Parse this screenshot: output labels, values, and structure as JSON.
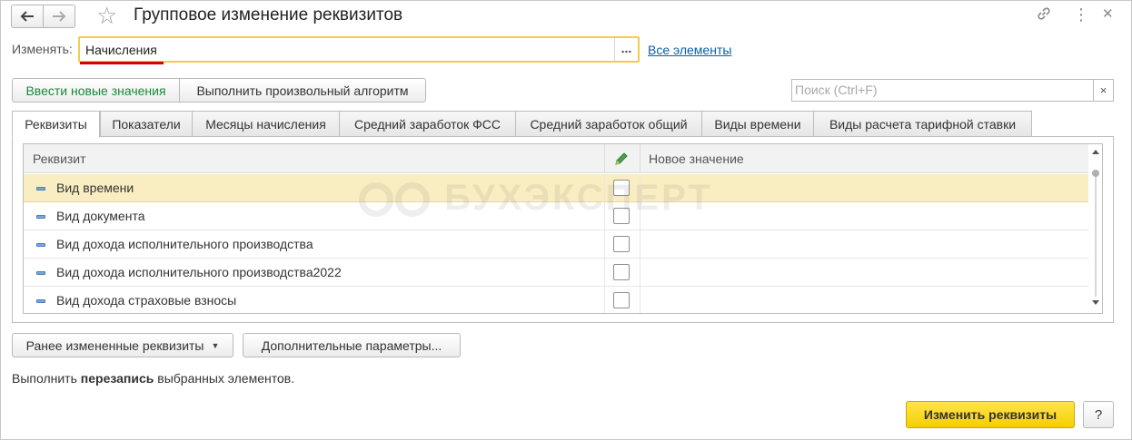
{
  "window": {
    "title": "Групповое изменение реквизитов",
    "back_icon": "arrow-left-icon",
    "forward_icon": "arrow-right-icon",
    "favorite_icon": "star-icon",
    "link_icon": "link-icon",
    "more_icon": "more-vertical-icon",
    "close_icon": "close-icon"
  },
  "change_row": {
    "label": "Изменять:",
    "value": "Начисления",
    "select_button": "...",
    "all_link": "Все элементы"
  },
  "toolbar": {
    "new_values": "Ввести новые значения",
    "custom_algorithm": "Выполнить произвольный алгоритм",
    "search_placeholder": "Поиск (Ctrl+F)",
    "search_clear": "×"
  },
  "tabs": [
    {
      "label": "Реквизиты",
      "active": true
    },
    {
      "label": "Показатели",
      "active": false
    },
    {
      "label": "Месяцы начисления",
      "active": false
    },
    {
      "label": "Средний заработок ФСС",
      "active": false
    },
    {
      "label": "Средний заработок общий",
      "active": false
    },
    {
      "label": "Виды времени",
      "active": false
    },
    {
      "label": "Виды расчета тарифной ставки",
      "active": false
    }
  ],
  "table": {
    "columns": {
      "attribute": "Реквизит",
      "new_value": "Новое значение"
    },
    "rows": [
      {
        "name": "Вид времени",
        "checked": false,
        "selected": true,
        "new_value": ""
      },
      {
        "name": "Вид документа",
        "checked": false,
        "selected": false,
        "new_value": ""
      },
      {
        "name": "Вид дохода исполнительного производства",
        "checked": false,
        "selected": false,
        "new_value": ""
      },
      {
        "name": "Вид дохода исполнительного производства2022",
        "checked": false,
        "selected": false,
        "new_value": ""
      },
      {
        "name": "Вид дохода страховые взносы",
        "checked": false,
        "selected": false,
        "new_value": ""
      }
    ]
  },
  "watermark": "БУХЭКСПЕРТ",
  "bottom": {
    "previously_changed": "Ранее измененные реквизиты",
    "extra_params": "Дополнительные параметры...",
    "info_prefix": "Выполнить ",
    "info_bold": "перезапись",
    "info_suffix": " выбранных элементов.",
    "apply": "Изменить реквизиты",
    "help": "?"
  },
  "colors": {
    "accent_yellow": "#f5cf00",
    "selected_row": "#f9eec1",
    "link": "#0a5fa8",
    "green_text": "#1a8a3a",
    "red_underline": "#d40000"
  }
}
